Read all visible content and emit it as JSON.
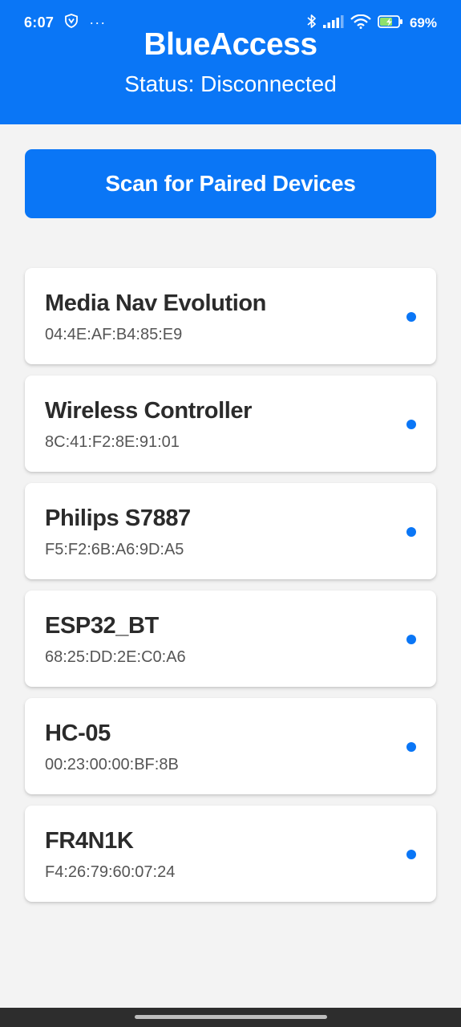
{
  "status_bar": {
    "time": "6:07",
    "overflow": "···",
    "battery_percent": "69%",
    "icons": [
      "vpn-shield-icon",
      "bluetooth-icon",
      "signal-icon",
      "wifi-icon",
      "battery-charging-icon"
    ]
  },
  "header": {
    "title": "BlueAccess",
    "status": "Status: Disconnected"
  },
  "scan_button": {
    "label": "Scan for Paired Devices"
  },
  "devices": [
    {
      "name": "Media Nav Evolution",
      "mac": "04:4E:AF:B4:85:E9"
    },
    {
      "name": "Wireless Controller",
      "mac": "8C:41:F2:8E:91:01"
    },
    {
      "name": "Philips S7887",
      "mac": "F5:F2:6B:A6:9D:A5"
    },
    {
      "name": "ESP32_BT",
      "mac": "68:25:DD:2E:C0:A6"
    },
    {
      "name": "HC-05",
      "mac": "00:23:00:00:BF:8B"
    },
    {
      "name": "FR4N1K",
      "mac": "F4:26:79:60:07:24"
    }
  ],
  "colors": {
    "accent": "#0a76f6",
    "background": "#f3f3f3",
    "card": "#ffffff",
    "text_primary": "#2b2b2b",
    "text_secondary": "#555555"
  }
}
